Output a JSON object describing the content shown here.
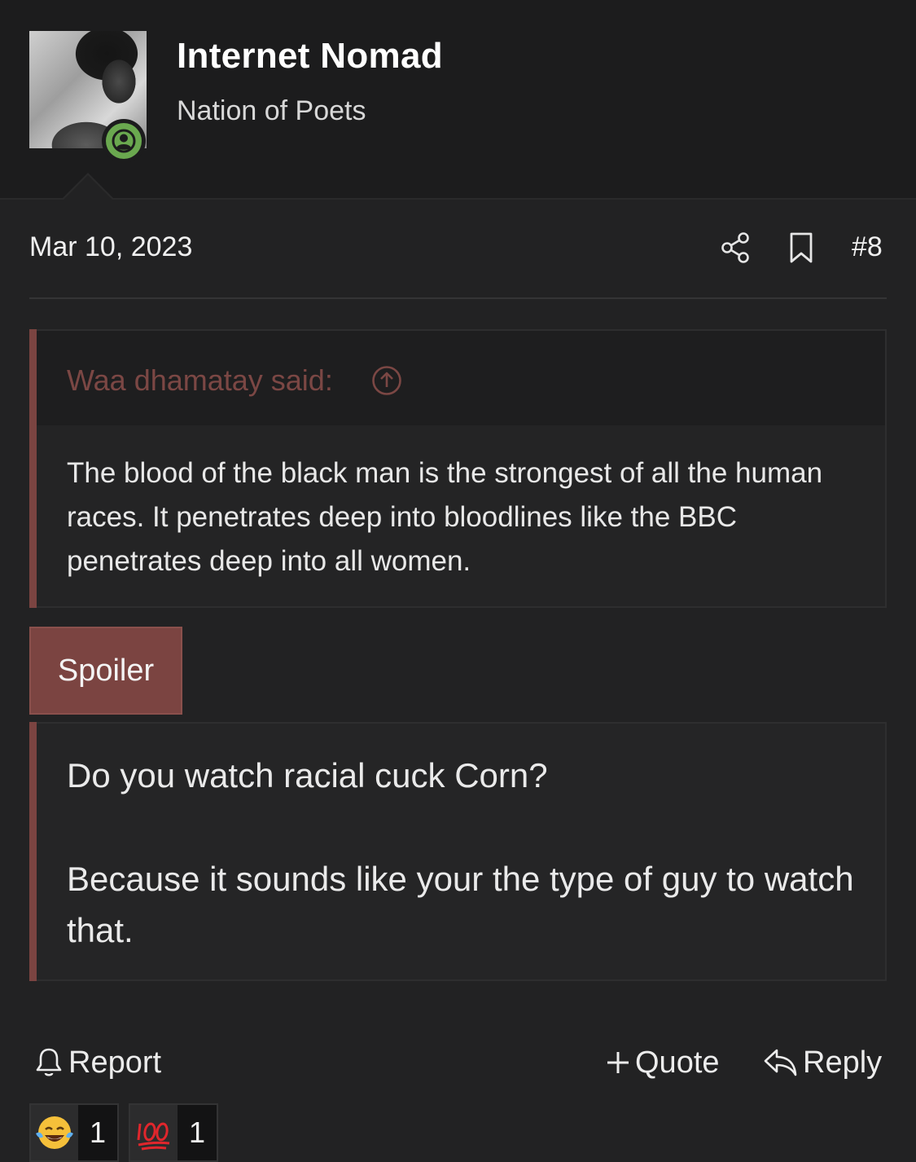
{
  "user": {
    "name": "Internet Nomad",
    "title": "Nation of Poets",
    "status": "online"
  },
  "post": {
    "date": "Mar 10, 2023",
    "number": "#8"
  },
  "quote": {
    "attribution": "Waa dhamatay said:",
    "text": "The blood of the black man is the strongest of all the human races. It penetrates deep into bloodlines like the BBC penetrates deep into all women."
  },
  "spoiler": {
    "label": "Spoiler",
    "paragraph1": "Do you watch racial cuck Corn?",
    "paragraph2": "Because it sounds like your the type of guy to watch that."
  },
  "actions": {
    "report": "Report",
    "quote": "Quote",
    "reply": "Reply"
  },
  "reactions": [
    {
      "icon": "tears-of-joy-emoji-icon",
      "count": "1"
    },
    {
      "icon": "hundred-points-emoji-icon",
      "count": "1"
    }
  ],
  "colors": {
    "accent": "#7b4441",
    "online": "#6aa84f",
    "background": "#222223"
  }
}
